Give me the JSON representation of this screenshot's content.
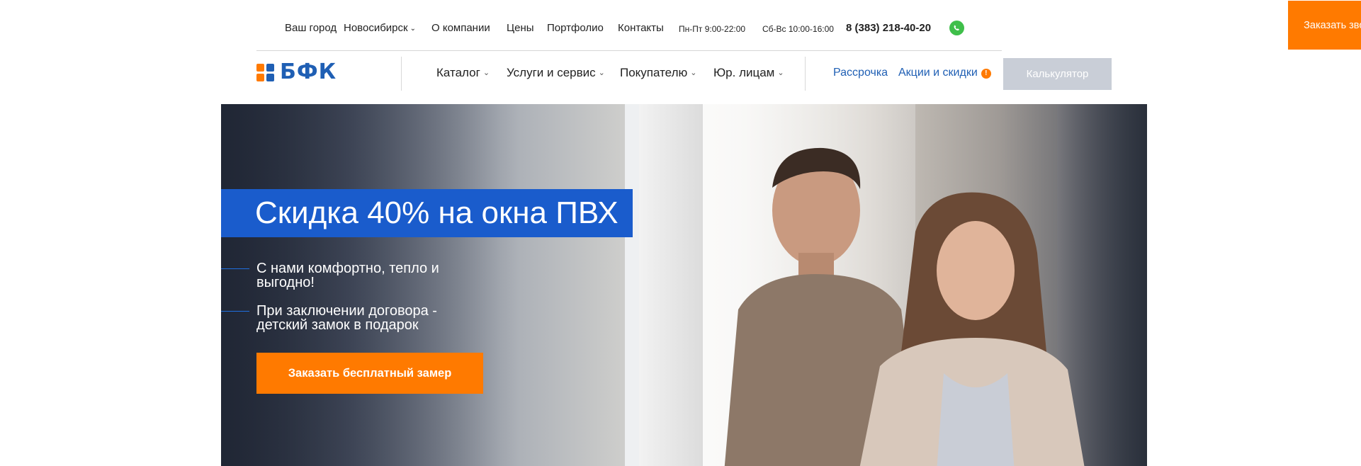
{
  "topbar": {
    "city_label": "Ваш город",
    "city_value": "Новосибирск",
    "links": [
      "О компании",
      "Цены",
      "Портфолио",
      "Контакты"
    ],
    "hours_weekday": "Пн-Пт 9:00-22:00",
    "hours_weekend": "Сб-Вс 10:00-16:00",
    "phone": "8 (383) 218-40-20",
    "order_call": "Заказать звонок"
  },
  "logo": {
    "text": "БФК"
  },
  "nav": {
    "catalog": "Каталог",
    "services": "Услуги и сервис",
    "buyer": "Покупателю",
    "legal": "Юр. лицам",
    "installment": "Рассрочка",
    "promo": "Акции и скидки",
    "promo_badge": "!",
    "calculator": "Калькулятор"
  },
  "hero": {
    "title": "Скидка 40% на окна ПВХ",
    "bullet1": "С нами комфортно, тепло и выгодно!",
    "bullet2": "При заключении договора - детский замок в подарок",
    "cta": "Заказать бесплатный замер"
  },
  "colors": {
    "accent": "#ff7a00",
    "brand_blue": "#1f5fb4",
    "hero_title_bg": "#1a5ccc"
  }
}
